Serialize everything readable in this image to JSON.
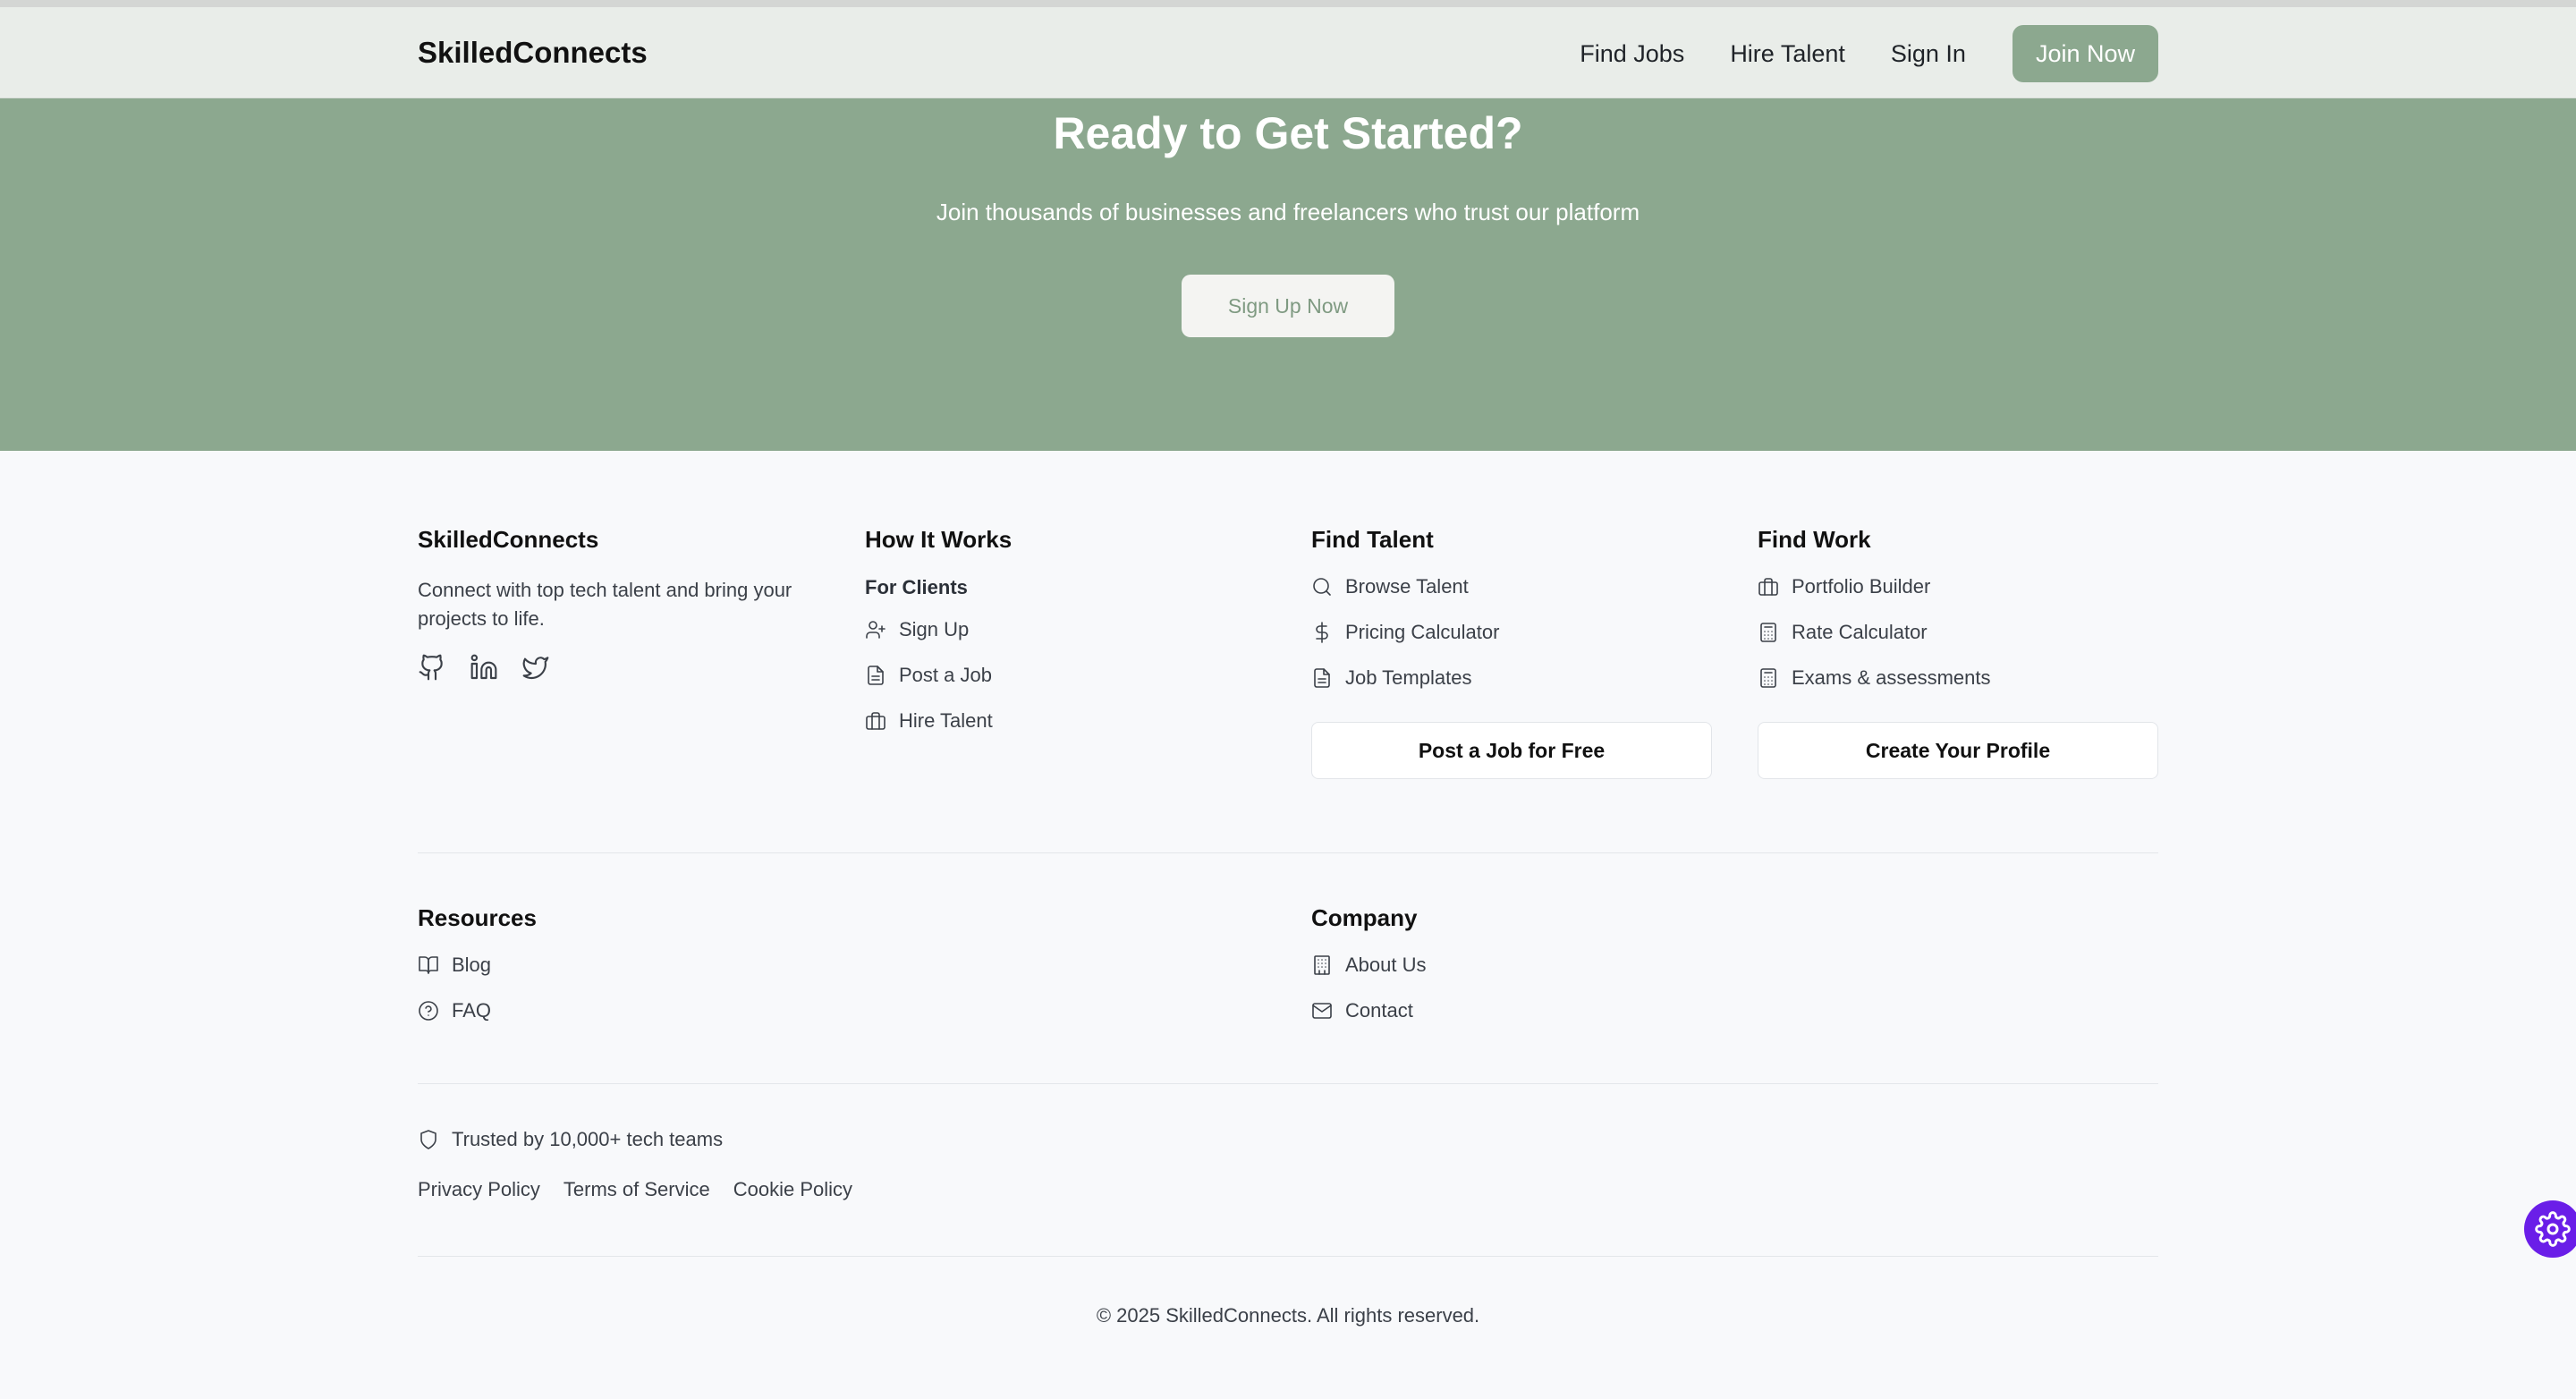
{
  "nav": {
    "brand": "SkilledConnects",
    "links": [
      "Find Jobs",
      "Hire Talent",
      "Sign In"
    ],
    "cta": "Join Now"
  },
  "hero": {
    "title": "Ready to Get Started?",
    "subtitle": "Join thousands of businesses and freelancers who trust our platform",
    "button": "Sign Up Now"
  },
  "footer": {
    "about": {
      "title": "SkilledConnects",
      "description": "Connect with top tech talent and bring your projects to life.",
      "social_icons": [
        "github-icon",
        "linkedin-icon",
        "twitter-icon"
      ]
    },
    "how_it_works": {
      "title": "How It Works",
      "subheading": "For Clients",
      "links": [
        {
          "label": "Sign Up",
          "icon": "user-plus-icon"
        },
        {
          "label": "Post a Job",
          "icon": "document-icon"
        },
        {
          "label": "Hire Talent",
          "icon": "briefcase-icon"
        }
      ]
    },
    "find_talent": {
      "title": "Find Talent",
      "links": [
        {
          "label": "Browse Talent",
          "icon": "search-icon"
        },
        {
          "label": "Pricing Calculator",
          "icon": "dollar-icon"
        },
        {
          "label": "Job Templates",
          "icon": "document-icon"
        }
      ],
      "button": "Post a Job for Free"
    },
    "find_work": {
      "title": "Find Work",
      "links": [
        {
          "label": "Portfolio Builder",
          "icon": "briefcase-icon"
        },
        {
          "label": "Rate Calculator",
          "icon": "calculator-icon"
        },
        {
          "label": "Exams & assessments",
          "icon": "calculator-icon"
        }
      ],
      "button": "Create Your Profile"
    },
    "resources": {
      "title": "Resources",
      "links": [
        {
          "label": "Blog",
          "icon": "book-icon"
        },
        {
          "label": "FAQ",
          "icon": "help-circle-icon"
        }
      ]
    },
    "company": {
      "title": "Company",
      "links": [
        {
          "label": "About Us",
          "icon": "building-icon"
        },
        {
          "label": "Contact",
          "icon": "mail-icon"
        }
      ]
    },
    "trust": "Trusted by 10,000+ tech teams",
    "legal": [
      "Privacy Policy",
      "Terms of Service",
      "Cookie Policy"
    ],
    "copyright": "© 2025 SkilledConnects. All rights reserved."
  },
  "colors": {
    "accent": "#8ca88f",
    "navbar_bg": "#e9ede9",
    "footer_bg": "#f8f9fb",
    "fab": "#6a1ee8"
  }
}
